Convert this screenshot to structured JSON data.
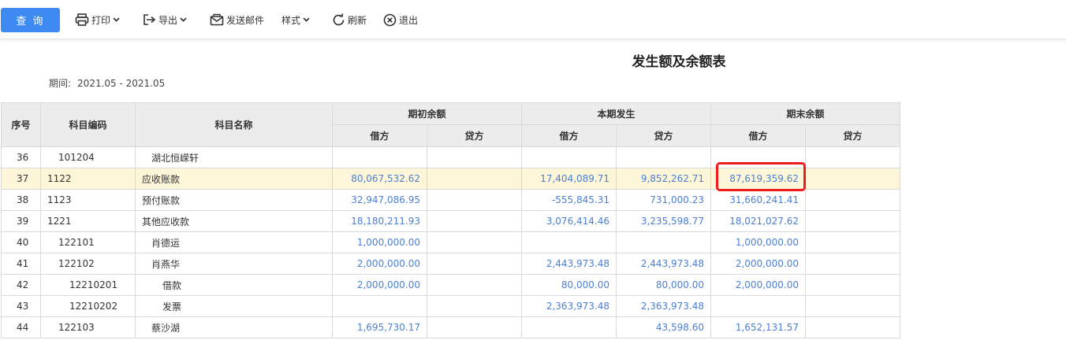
{
  "toolbar": {
    "query_label": "查 询",
    "print_label": "打印",
    "export_label": "导出",
    "email_label": "发送邮件",
    "style_label": "样式",
    "refresh_label": "刷新",
    "exit_label": "退出"
  },
  "report": {
    "title": "发生额及余额表",
    "period_label": "期间:",
    "period_value": "2021.05 - 2021.05"
  },
  "table": {
    "headers": {
      "seq": "序号",
      "code": "科目编码",
      "name": "科目名称",
      "opening": "期初余额",
      "period": "本期发生",
      "closing": "期末余额",
      "debit": "借方",
      "credit": "贷方"
    },
    "rows": [
      {
        "seq": "36",
        "code": "101204",
        "name": "湖北恒嵘轩",
        "level": 2,
        "od": "",
        "oc": "",
        "pd": "",
        "pc": "",
        "cd": "",
        "cc": ""
      },
      {
        "seq": "37",
        "code": "1122",
        "name": "应收账款",
        "level": 1,
        "od": "80,067,532.62",
        "oc": "",
        "pd": "17,404,089.71",
        "pc": "9,852,262.71",
        "cd": "87,619,359.62",
        "cc": ""
      },
      {
        "seq": "38",
        "code": "1123",
        "name": "预付账款",
        "level": 1,
        "od": "32,947,086.95",
        "oc": "",
        "pd": "-555,845.31",
        "pc": "731,000.23",
        "cd": "31,660,241.41",
        "cc": ""
      },
      {
        "seq": "39",
        "code": "1221",
        "name": "其他应收款",
        "level": 1,
        "od": "18,180,211.93",
        "oc": "",
        "pd": "3,076,414.46",
        "pc": "3,235,598.77",
        "cd": "18,021,027.62",
        "cc": ""
      },
      {
        "seq": "40",
        "code": "122101",
        "name": "肖德运",
        "level": 2,
        "od": "1,000,000.00",
        "oc": "",
        "pd": "",
        "pc": "",
        "cd": "1,000,000.00",
        "cc": ""
      },
      {
        "seq": "41",
        "code": "122102",
        "name": "肖燕华",
        "level": 2,
        "od": "2,000,000.00",
        "oc": "",
        "pd": "2,443,973.48",
        "pc": "2,443,973.48",
        "cd": "2,000,000.00",
        "cc": ""
      },
      {
        "seq": "42",
        "code": "12210201",
        "name": "借款",
        "level": 3,
        "od": "2,000,000.00",
        "oc": "",
        "pd": "80,000.00",
        "pc": "80,000.00",
        "cd": "2,000,000.00",
        "cc": ""
      },
      {
        "seq": "43",
        "code": "12210202",
        "name": "发票",
        "level": 3,
        "od": "",
        "oc": "",
        "pd": "2,363,973.48",
        "pc": "2,363,973.48",
        "cd": "",
        "cc": ""
      },
      {
        "seq": "44",
        "code": "122103",
        "name": "蔡沙湖",
        "level": 2,
        "od": "1,695,730.17",
        "oc": "",
        "pd": "",
        "pc": "43,598.60",
        "cd": "1,652,131.57",
        "cc": ""
      }
    ],
    "highlight_row": 1
  },
  "colors": {
    "primary": "#3d8bf2",
    "amount_text": "#4a7fd4",
    "highlight_row": "#fdf6d8",
    "annotation_box": "#ee1c1c"
  }
}
